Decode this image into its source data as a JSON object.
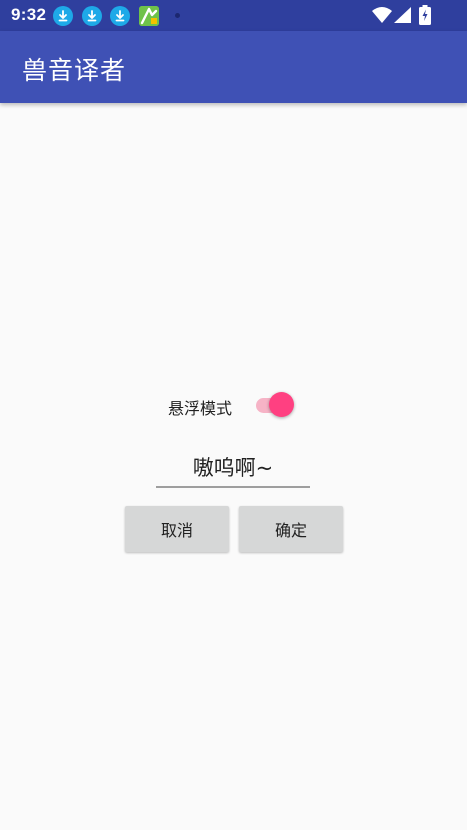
{
  "status_bar": {
    "time": "9:32",
    "background": "#2f3f9e",
    "notifications": [
      "download-icon",
      "download-icon",
      "download-icon",
      "app-notification-icon",
      "dot-icon"
    ],
    "system_icons": [
      "wifi-icon",
      "cellular-signal-icon",
      "battery-charging-icon"
    ]
  },
  "app_bar": {
    "title": "兽音译者",
    "background": "#3f51b5"
  },
  "dialog": {
    "float_mode_label": "悬浮模式",
    "float_mode_enabled": true,
    "toggle_color": "#ff4081",
    "input_value": "嗷呜啊~",
    "cancel_label": "取消",
    "confirm_label": "确定"
  }
}
